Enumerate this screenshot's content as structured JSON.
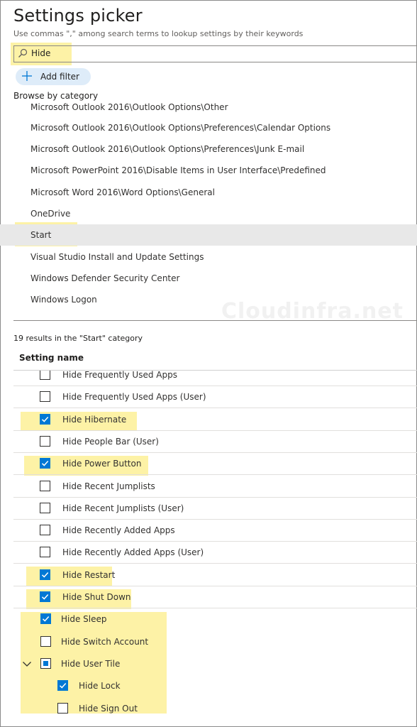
{
  "title": "Settings picker",
  "subtitle": "Use commas \",\" among search terms to lookup settings by their keywords",
  "search": {
    "value": "Hide"
  },
  "add_filter_label": "Add filter",
  "browse_label": "Browse by category",
  "categories": [
    {
      "label": "Microsoft Outlook 2016\\Outlook Options\\Other",
      "selected": false
    },
    {
      "label": "Microsoft Outlook 2016\\Outlook Options\\Preferences\\Calendar Options",
      "selected": false
    },
    {
      "label": "Microsoft Outlook 2016\\Outlook Options\\Preferences\\Junk E-mail",
      "selected": false
    },
    {
      "label": "Microsoft PowerPoint 2016\\Disable Items in User Interface\\Predefined",
      "selected": false
    },
    {
      "label": "Microsoft Word 2016\\Word Options\\General",
      "selected": false
    },
    {
      "label": "OneDrive",
      "selected": false
    },
    {
      "label": "Start",
      "selected": true
    },
    {
      "label": "Visual Studio Install and Update Settings",
      "selected": false
    },
    {
      "label": "Windows Defender Security Center",
      "selected": false
    },
    {
      "label": "Windows Logon",
      "selected": false
    }
  ],
  "watermark": "Cloudinfra.net",
  "results_label": "19 results in the \"Start\" category",
  "column_header": "Setting name",
  "settings": [
    {
      "label": "Hide Frequently Used Apps",
      "state": "unchecked"
    },
    {
      "label": "Hide Frequently Used Apps (User)",
      "state": "unchecked"
    },
    {
      "label": "Hide Hibernate",
      "state": "checked"
    },
    {
      "label": "Hide People Bar (User)",
      "state": "unchecked"
    },
    {
      "label": "Hide Power Button",
      "state": "checked"
    },
    {
      "label": "Hide Recent Jumplists",
      "state": "unchecked"
    },
    {
      "label": "Hide Recent Jumplists (User)",
      "state": "unchecked"
    },
    {
      "label": "Hide Recently Added Apps",
      "state": "unchecked"
    },
    {
      "label": "Hide Recently Added Apps (User)",
      "state": "unchecked"
    },
    {
      "label": "Hide Restart",
      "state": "checked"
    },
    {
      "label": "Hide Shut Down",
      "state": "checked"
    },
    {
      "label": "Hide Sleep",
      "state": "checked"
    },
    {
      "label": "Hide Switch Account",
      "state": "unchecked"
    },
    {
      "label": "Hide User Tile",
      "state": "indeterminate",
      "expanded": true
    },
    {
      "label": "Hide Lock",
      "state": "checked",
      "child": true
    },
    {
      "label": "Hide Sign Out",
      "state": "unchecked",
      "child": true
    }
  ],
  "colors": {
    "accent": "#0078d4",
    "highlight": "#fdf2a6",
    "selected_row": "#e8e8e8",
    "filter_pill": "#deecf9"
  }
}
